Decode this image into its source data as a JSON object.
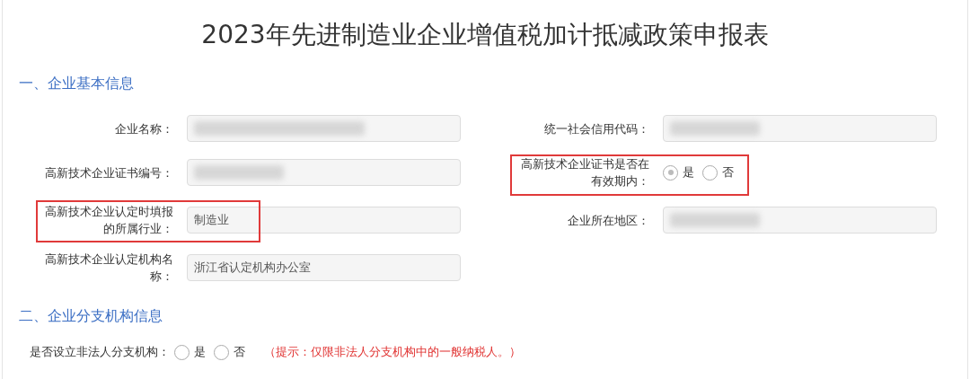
{
  "title": "2023年先进制造业企业增值税加计抵减政策申报表",
  "sections": [
    {
      "heading": "一、企业基本信息",
      "fields": [
        {
          "kind": "text",
          "label": "企业名称：",
          "redacted": true,
          "highlighted": false
        },
        {
          "kind": "text",
          "label": "统一社会信用代码：",
          "redacted": true,
          "highlighted": false
        },
        {
          "kind": "text",
          "label": "高新技术企业证书编号：",
          "redacted": true,
          "highlighted": false
        },
        {
          "kind": "radio",
          "label": "高新技术企业证书是否在有效期内：",
          "highlighted": true,
          "options": [
            {
              "label": "是",
              "selected": true
            },
            {
              "label": "否",
              "selected": false
            }
          ]
        },
        {
          "kind": "text",
          "label": "高新技术企业认定时填报的所属行业：",
          "value": "制造业",
          "highlighted": true
        },
        {
          "kind": "text",
          "label": "企业所在地区：",
          "redacted": true,
          "highlighted": false
        },
        {
          "kind": "text",
          "label": "高新技术企业认定机构名称：",
          "value": "浙江省认定机构办公室",
          "highlighted": false
        }
      ]
    },
    {
      "heading": "二、企业分支机构信息",
      "question": {
        "label": "是否设立非法人分支机构：",
        "options": [
          {
            "label": "是",
            "selected": false
          },
          {
            "label": "否",
            "selected": false
          }
        ],
        "hint": "（提示：仅限非法人分支机构中的一般纳税人。）"
      }
    }
  ]
}
